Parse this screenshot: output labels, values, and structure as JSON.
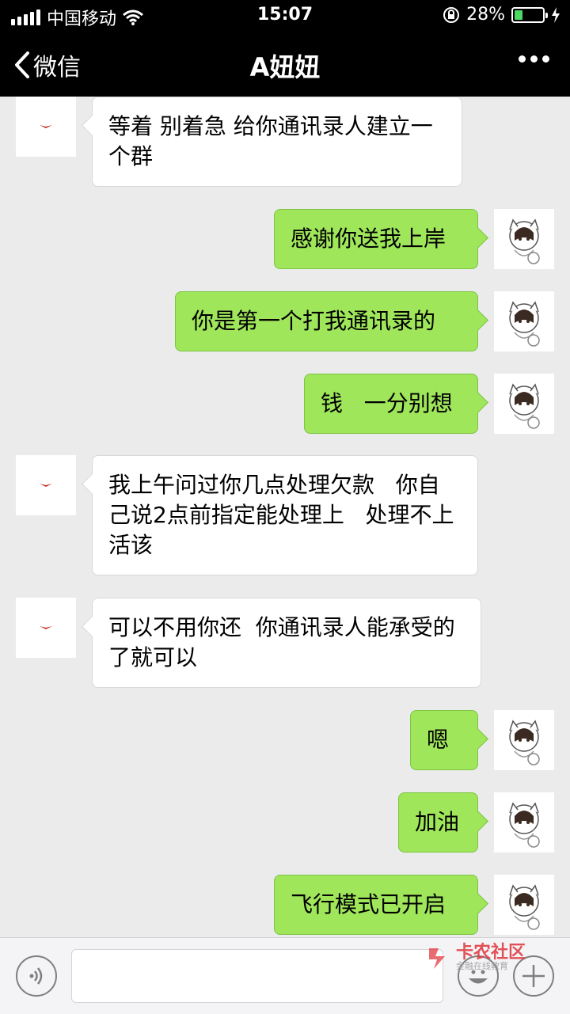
{
  "status_bar": {
    "carrier": "中国移动",
    "time": "15:07",
    "battery": "28%",
    "battery_level": 0.28
  },
  "nav": {
    "back_label": "微信",
    "title": "A妞妞"
  },
  "messages": [
    {
      "side": "in",
      "text": "等着 别着急  给你通讯录人建立一个群"
    },
    {
      "side": "out",
      "text": "感谢你送我上岸"
    },
    {
      "side": "out",
      "text": "你是第一个打我通讯录的"
    },
    {
      "side": "out",
      "text": "钱   一分别想"
    },
    {
      "side": "in",
      "text": "我上午问过你几点处理欠款   你自己说2点前指定能处理上   处理不上活该"
    },
    {
      "side": "in",
      "text": "可以不用你还  你通讯录人能承受的了就可以"
    },
    {
      "side": "out",
      "text": "嗯"
    },
    {
      "side": "out",
      "text": "加油"
    },
    {
      "side": "out",
      "text": "飞行模式已开启"
    }
  ],
  "watermark": {
    "main": "卡农社区",
    "sub": "金融在线教育"
  },
  "colors": {
    "out_bubble": "#9fe65b",
    "in_bubble": "#ffffff",
    "background": "#ebebeb",
    "battery": "#4cd964"
  }
}
